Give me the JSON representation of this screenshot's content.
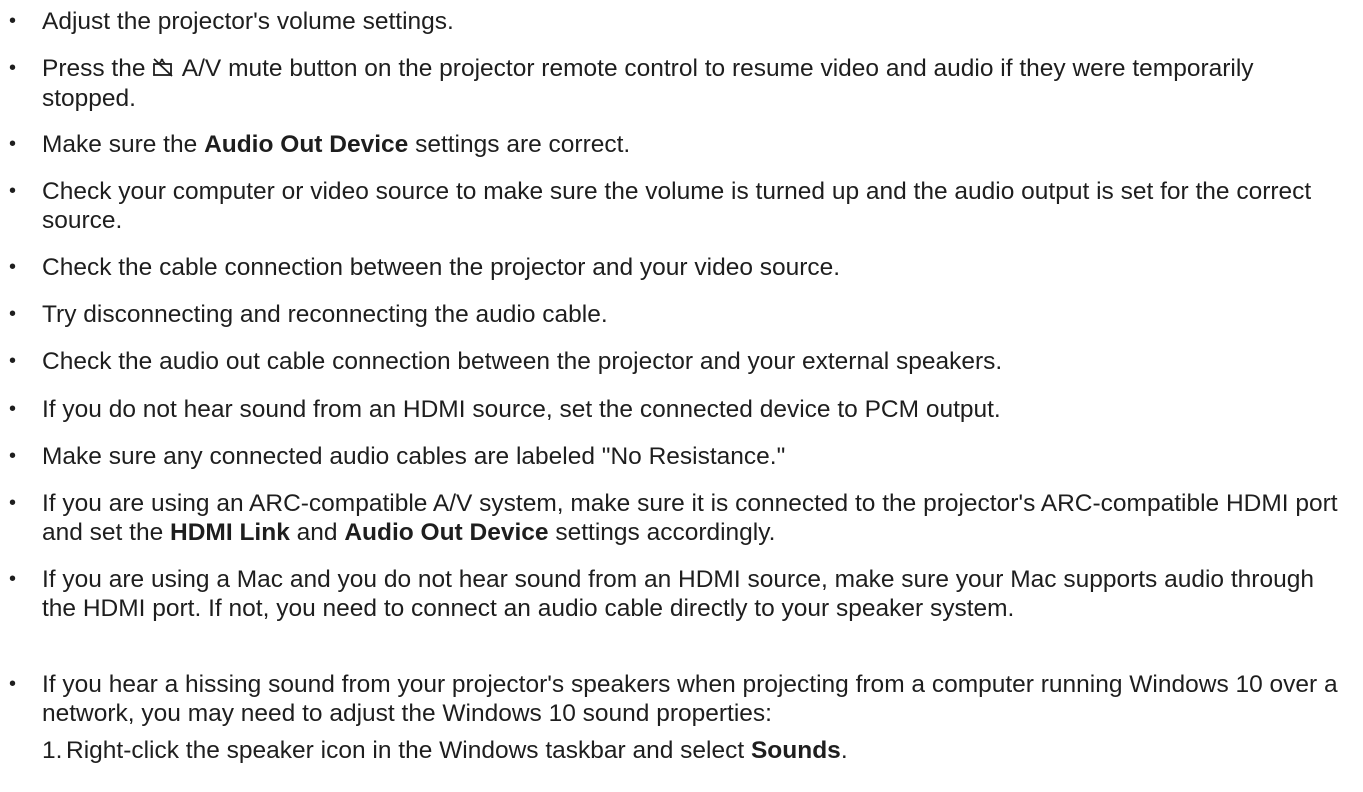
{
  "bullets": [
    {
      "text": "Adjust the projector's volume settings."
    },
    {
      "before": "Press the ",
      "icon": "av-mute-icon",
      "after": " A/V mute button on the projector remote control to resume video and audio if they were temporarily stopped."
    },
    {
      "t1": "Make sure the ",
      "b1": "Audio Out Device",
      "t2": " settings are correct."
    },
    {
      "text": "Check your computer or video source to make sure the volume is turned up and the audio output is set for the correct source."
    },
    {
      "text": "Check the cable connection between the projector and your video source."
    },
    {
      "text": "Try disconnecting and reconnecting the audio cable."
    },
    {
      "text": "Check the audio out cable connection between the projector and your external speakers."
    },
    {
      "text": "If you do not hear sound from an HDMI source, set the connected device to PCM output."
    },
    {
      "text": "Make sure any connected audio cables are labeled \"No Resistance.\""
    },
    {
      "t1": "If you are using an ARC-compatible A/V system, make sure it is connected to the projector's ARC-compatible HDMI port and set the ",
      "b1": "HDMI Link",
      "t2": " and ",
      "b2": "Audio Out Device",
      "t3": " settings accordingly."
    },
    {
      "text": "If you are using a Mac and you do not hear sound from an HDMI source, make sure your Mac supports audio through the HDMI port. If not, you need to connect an audio cable directly to your speaker system."
    },
    {
      "text": "If you hear a hissing sound from your projector's speakers when projecting from a computer running Windows 10 over a network, you may need to adjust the Windows 10 sound properties:"
    }
  ],
  "bullet_glyph": "•",
  "steps": [
    {
      "num": "1.",
      "t1": "Right-click the speaker icon in the Windows taskbar and select ",
      "b1": "Sounds",
      "t2": "."
    }
  ]
}
